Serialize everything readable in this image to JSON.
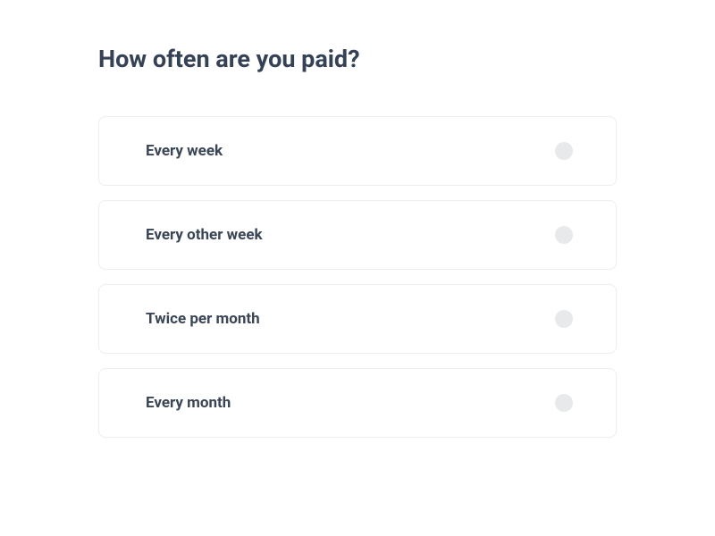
{
  "heading": "How often are you paid?",
  "options": [
    {
      "label": "Every week"
    },
    {
      "label": "Every other week"
    },
    {
      "label": "Twice per month"
    },
    {
      "label": "Every month"
    }
  ]
}
